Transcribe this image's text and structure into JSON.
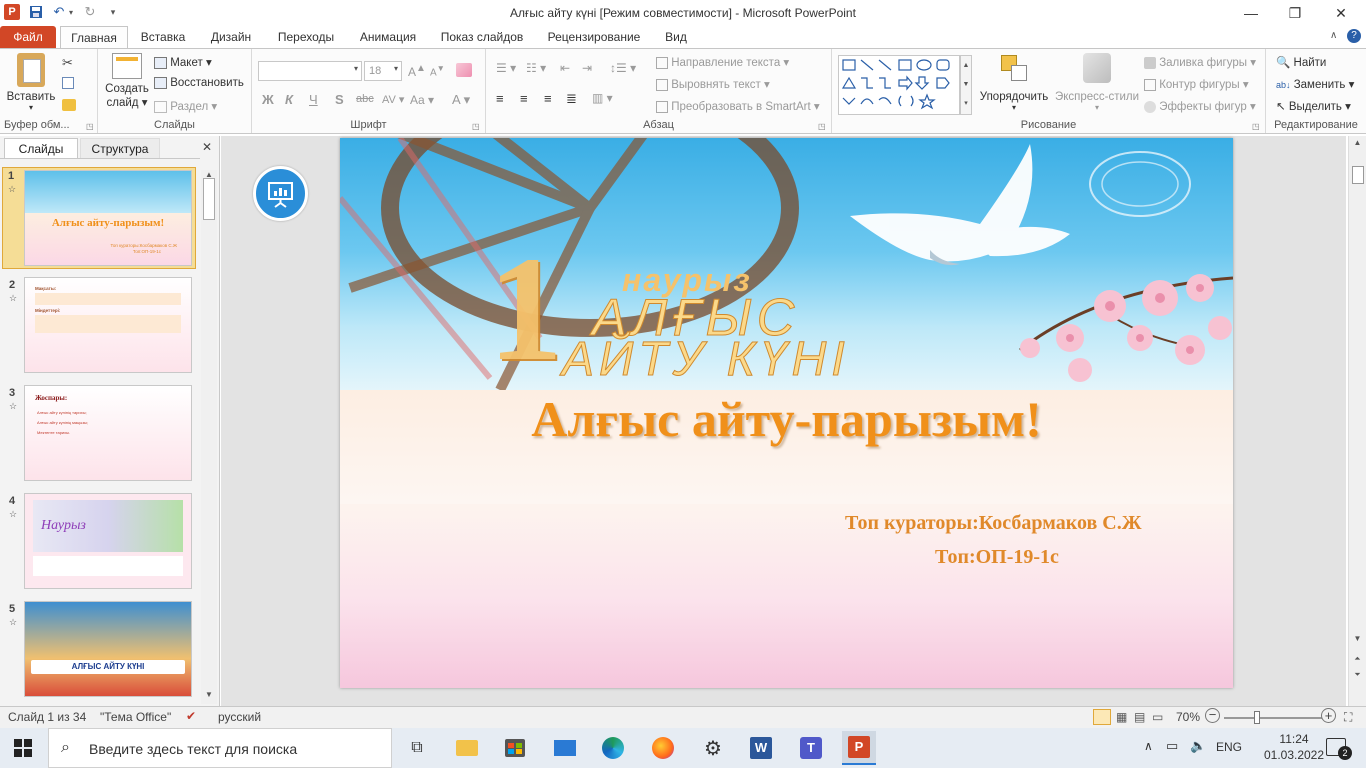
{
  "window": {
    "title": "Алғыс айту күні [Режим совместимости]  -  Microsoft PowerPoint"
  },
  "tabs": {
    "file": "Файл",
    "items": [
      "Главная",
      "Вставка",
      "Дизайн",
      "Переходы",
      "Анимация",
      "Показ слайдов",
      "Рецензирование",
      "Вид"
    ],
    "active": "Главная"
  },
  "ribbon": {
    "clipboard": {
      "label": "Буфер обм...",
      "paste": "Вставить"
    },
    "slides": {
      "label": "Слайды",
      "create": "Создать",
      "create2": "слайд",
      "layout": "Макет",
      "reset": "Восстановить",
      "section": "Раздел"
    },
    "font": {
      "label": "Шрифт",
      "size": "18",
      "bold": "Ж",
      "italic": "К",
      "underline": "Ч",
      "shadow": "S",
      "strike": "abc",
      "spacing": "AV",
      "case": "Aa"
    },
    "paragraph": {
      "label": "Абзац",
      "direction": "Направление текста",
      "align": "Выровнять текст",
      "smartart": "Преобразовать в SmartArt"
    },
    "drawing": {
      "label": "Рисование",
      "arrange": "Упорядочить",
      "styles": "Экспресс-стили",
      "fill": "Заливка фигуры",
      "outline": "Контур фигуры",
      "effects": "Эффекты фигур"
    },
    "editing": {
      "label": "Редактирование",
      "find": "Найти",
      "replace": "Заменить",
      "select": "Выделить"
    }
  },
  "panel": {
    "tab_slides": "Слайды",
    "tab_outline": "Структура",
    "thumbs": [
      {
        "num": "1",
        "title": "Алғыс айту-парызым!",
        "sub": "Топ кураторы:Косбармаков С.Ж",
        "sub2": "Топ:ОП-19-1с"
      },
      {
        "num": "2",
        "lines": [
          "Мақсаты:",
          "Мақсаты",
          "Міндеттері:"
        ]
      },
      {
        "num": "3",
        "title": "Жоспары:",
        "lines": [
          "Алғыс айту күнінің тарихы;",
          "Алғыс айту күнінің маңызы;",
          "Мектепте тарихы."
        ]
      },
      {
        "num": "4",
        "caption": "Наурыз"
      },
      {
        "num": "5",
        "caption": "АЛҒЫС АЙТУ КҮНІ"
      }
    ]
  },
  "slide": {
    "header_line1": "наурыз",
    "header_line2": "АЛҒЫС",
    "header_line3": "АЙТУ КҮНІ",
    "header_num": "1",
    "title": "Алғыс айту-парызым!",
    "curator": "Топ кураторы:Косбармаков С.Ж",
    "group": "Топ:ОП-19-1с"
  },
  "status": {
    "slide_info": "Слайд 1 из 34",
    "theme": "\"Тема Office\"",
    "language": "русский",
    "zoom": "70%"
  },
  "taskbar": {
    "search_placeholder": "Введите здесь текст для поиска",
    "lang": "ENG",
    "time": "11:24",
    "date": "01.03.2022",
    "notifications": "2"
  },
  "colors": {
    "file_tab": "#d24726",
    "title_orange": "#f0901a",
    "sub_orange": "#e0892a",
    "accent_blue": "#2a5fa8"
  }
}
